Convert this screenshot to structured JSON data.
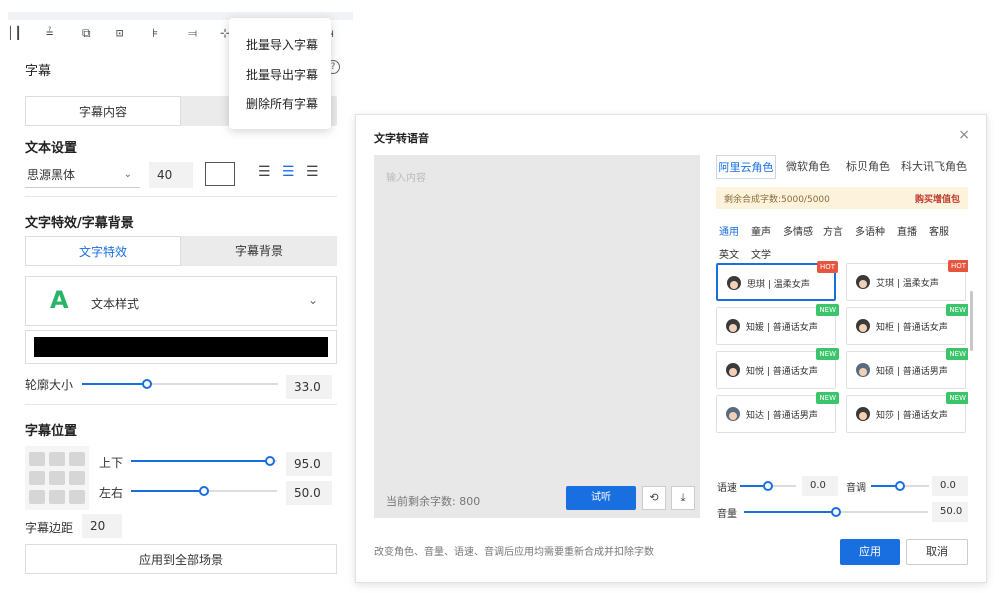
{
  "toolbar": {
    "align_icons": [
      "align-left-icon",
      "align-top-icon",
      "align-center-icon",
      "align-middle-icon",
      "align-horizontal-icon",
      "align-right-icon",
      "align-distribute-icon",
      "align-end-icon"
    ]
  },
  "panel": {
    "title": "字幕",
    "tabs": [
      {
        "label": "字幕内容",
        "active": true
      },
      {
        "label": "",
        "active": false
      }
    ],
    "text_settings": {
      "title": "文本设置",
      "font": "思源黑体",
      "size": "40"
    },
    "effects": {
      "title": "文字特效/字幕背景",
      "tabs": [
        {
          "label": "文字特效",
          "active": true
        },
        {
          "label": "字幕背景",
          "active": false
        }
      ],
      "style_label": "文本样式",
      "style_glyph": "A",
      "outline_label": "轮廓大小",
      "outline_value": "33.0",
      "outline_fraction": 0.33
    },
    "position": {
      "title": "字幕位置",
      "vertical_label": "上下",
      "vertical_value": "95.0",
      "vertical_fraction": 0.95,
      "horizontal_label": "左右",
      "horizontal_value": "50.0",
      "horizontal_fraction": 0.5,
      "margin_label": "字幕边距",
      "margin_value": "20"
    },
    "apply_all": "应用到全部场景"
  },
  "menu": {
    "items": [
      "批量导入字幕",
      "批量导出字幕",
      "删除所有字幕"
    ]
  },
  "dialog": {
    "title": "文字转语音",
    "close": "×",
    "textarea_placeholder": "输入内容",
    "remaining_label": "当前剩余字数: 800",
    "listen_button": "试听",
    "history_icon": "history-icon",
    "download_icon": "download-icon",
    "vendors": [
      {
        "label": "阿里云角色",
        "active": true
      },
      {
        "label": "微软角色",
        "active": false
      },
      {
        "label": "标贝角色",
        "active": false
      },
      {
        "label": "科大讯飞角色",
        "active": false
      }
    ],
    "quota_text": "剩余合成字数:5000/5000",
    "quota_buy": "购买增值包",
    "categories_row1": [
      {
        "label": "通用",
        "active": true
      },
      {
        "label": "童声",
        "active": false
      },
      {
        "label": "多情感",
        "active": false
      },
      {
        "label": "方言",
        "active": false
      },
      {
        "label": "多语种",
        "active": false
      },
      {
        "label": "直播",
        "active": false
      },
      {
        "label": "客服",
        "active": false
      }
    ],
    "categories_row2": [
      {
        "label": "英文",
        "active": false
      },
      {
        "label": "文学",
        "active": false
      }
    ],
    "voices": [
      {
        "name": "思琪 | 温柔女声",
        "tag": "HOT",
        "gender": "female",
        "selected": true
      },
      {
        "name": "艾琪 | 温柔女声",
        "tag": "HOT",
        "gender": "female",
        "selected": false
      },
      {
        "name": "知媛 | 普通话女声",
        "tag": "NEW",
        "gender": "female",
        "selected": false
      },
      {
        "name": "知柜 | 普通话女声",
        "tag": "NEW",
        "gender": "female",
        "selected": false
      },
      {
        "name": "知悦 | 普通话女声",
        "tag": "NEW",
        "gender": "female",
        "selected": false
      },
      {
        "name": "知硕 | 普通话男声",
        "tag": "NEW",
        "gender": "male",
        "selected": false
      },
      {
        "name": "知达 | 普通话男声",
        "tag": "NEW",
        "gender": "male",
        "selected": false
      },
      {
        "name": "知莎 | 普通话女声",
        "tag": "NEW",
        "gender": "female",
        "selected": false
      }
    ],
    "speed_label": "语速",
    "speed_value": "0.0",
    "pitch_label": "音调",
    "pitch_value": "0.0",
    "volume_label": "音量",
    "volume_value": "50.0",
    "footer_note": "改变角色、音量、语速、音调后应用均需要重新合成并扣除字数",
    "apply_button": "应用",
    "cancel_button": "取消"
  },
  "colors": {
    "accent": "#1a6fe0",
    "hot_tag": "#e8553f",
    "new_tag": "#3cc46b",
    "quota_bg": "#fdf3dc",
    "style_icon": "#2ab46a"
  }
}
